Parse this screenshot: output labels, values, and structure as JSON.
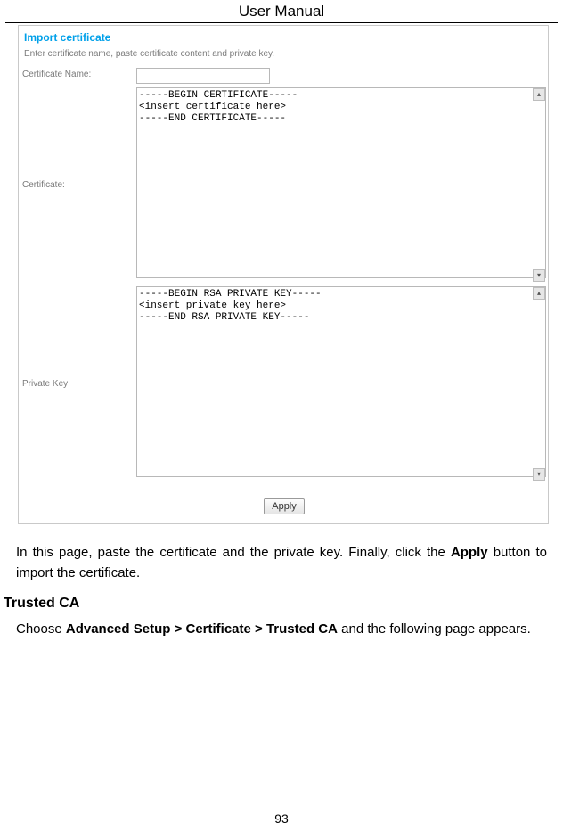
{
  "header": {
    "title": "User Manual"
  },
  "screenshot": {
    "section_title": "Import certificate",
    "section_desc": "Enter certificate name, paste certificate content and private key.",
    "cert_name": {
      "label": "Certificate Name:",
      "value": ""
    },
    "certificate": {
      "label": "Certificate:",
      "value": "-----BEGIN CERTIFICATE-----\n<insert certificate here>\n-----END CERTIFICATE-----"
    },
    "private_key": {
      "label": "Private Key:",
      "value": "-----BEGIN RSA PRIVATE KEY-----\n<insert private key here>\n-----END RSA PRIVATE KEY-----"
    },
    "apply_label": "Apply"
  },
  "para1": {
    "pre": "In this page, paste the certificate and the private key. Finally, click the ",
    "bold": "Apply",
    "post": " button to import the certificate."
  },
  "heading_trusted_ca": "Trusted CA",
  "para2": {
    "p1": "Choose ",
    "b1": "Advanced Setup > Certificate > Trusted CA",
    "p2": " and the following page appears."
  },
  "page_number": "93"
}
